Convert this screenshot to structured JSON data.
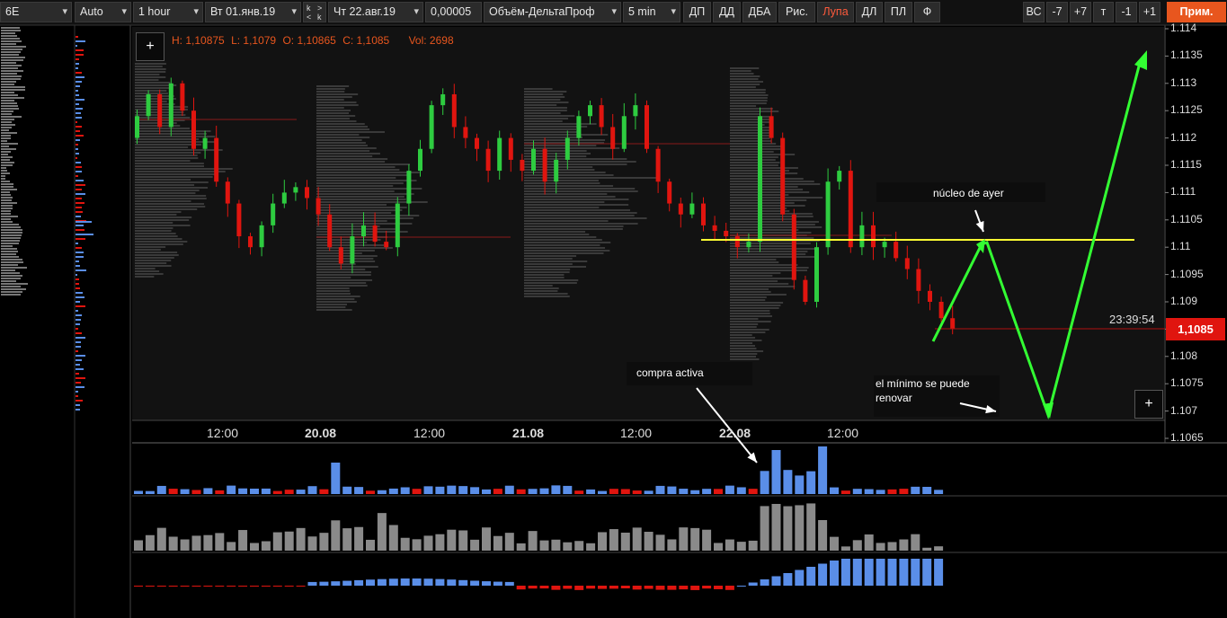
{
  "toolbar": {
    "symbol": "6E",
    "scale": "Auto",
    "timeframe": "1 hour",
    "date_from": "Вт 01.янв.19",
    "date_to": "Чт 22.авг.19",
    "tick_size": "0,00005",
    "indicator": "Объём-ДельтаПроф",
    "profile_period": "5 min",
    "step_k_top": "k",
    "step_gt": ">",
    "step_lt": "<",
    "step_k_bottom": "k",
    "tools": [
      "ДП",
      "ДД",
      "ДБА",
      "Рис.",
      "Лупа",
      "ДЛ",
      "ПЛ",
      "Ф"
    ],
    "right_tools": [
      "ВС",
      "-7",
      "+7",
      "т",
      "-1",
      "+1"
    ],
    "apply_label": "Прим."
  },
  "ohlc": {
    "high": "H: 1,10875",
    "low": "L: 1,1079",
    "open": "O: 1,10865",
    "close": "C: 1,1085",
    "vol": "Vol: 2698"
  },
  "y_axis": [
    "1.114",
    "1.1135",
    "1.113",
    "1.1125",
    "1.112",
    "1.1115",
    "1.111",
    "1.1105",
    "1.11",
    "1.1095",
    "1.109",
    "1.1085",
    "1.108",
    "1.1075",
    "1.107",
    "1.1065"
  ],
  "x_axis": [
    {
      "text": "12:00",
      "bold": false
    },
    {
      "text": "20.08",
      "bold": true
    },
    {
      "text": "12:00",
      "bold": false
    },
    {
      "text": "21.08",
      "bold": true
    },
    {
      "text": "12:00",
      "bold": false
    },
    {
      "text": "22.08",
      "bold": true
    },
    {
      "text": "12:00",
      "bold": false
    }
  ],
  "timer": "23:39:54",
  "current_price": "1,1085",
  "annotations": {
    "core": "núcleo de ayer",
    "buy": "compra activa",
    "min_line1": "el mínimo se puede",
    "min_line2": "renovar"
  },
  "plus_label": "+",
  "colors": {
    "up": "#2ecc40",
    "down": "#e0150f",
    "delta_pos": "#5a8ee8",
    "volume": "#8a8a8a",
    "accent": "#e8561e",
    "poc_line": "#ffff33",
    "arrow": "#33ff33"
  }
}
